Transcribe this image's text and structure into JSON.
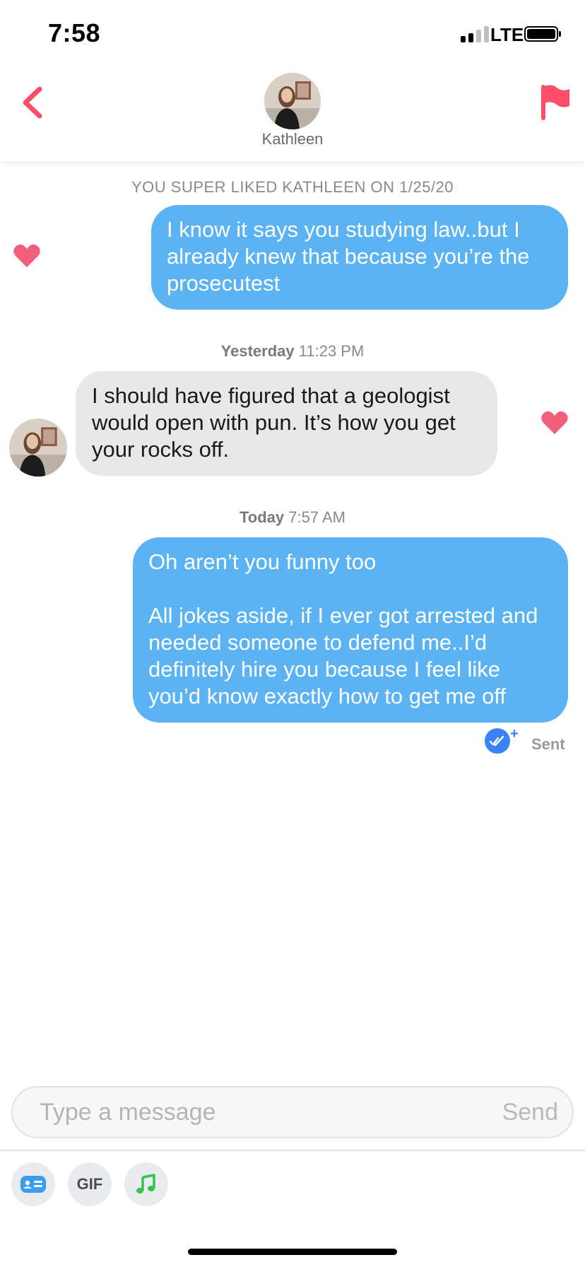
{
  "status_bar": {
    "time": "7:58",
    "network": "LTE",
    "signal_bars": 2,
    "signal_bars_total": 4
  },
  "header": {
    "name": "Kathleen",
    "back_icon": "chevron-left-icon",
    "report_icon": "flag-icon"
  },
  "super_like_notice": "YOU SUPER LIKED KATHLEEN ON 1/25/20",
  "messages": [
    {
      "direction": "out",
      "text": "I know it says you studying law..but I already knew that because you’re the prosecutest",
      "liked": true
    },
    {
      "timestamp_day": "Yesterday",
      "timestamp_time": "11:23 PM"
    },
    {
      "direction": "in",
      "sender": "Kathleen",
      "text": "I should have figured that a geologist would open with pun. It’s how you get your rocks off.",
      "liked": true
    },
    {
      "timestamp_day": "Today",
      "timestamp_time": "7:57 AM"
    },
    {
      "direction": "out",
      "text": "Oh aren’t you funny too\n\nAll jokes aside, if I ever got arrested and needed someone to defend me..I’d definitely hire you because I feel like you’d know exactly how to get me off",
      "status": "Sent"
    }
  ],
  "composer": {
    "placeholder": "Type a message",
    "send_label": "Send"
  },
  "toolbar": {
    "items": [
      {
        "icon": "contact-card-icon"
      },
      {
        "label": "GIF"
      },
      {
        "icon": "music-note-icon"
      }
    ]
  },
  "colors": {
    "accent": "#fd5068",
    "outgoing_bubble": "#5cb3f3",
    "incoming_bubble": "#e8e8e8",
    "read_receipt": "#3b82f6"
  }
}
